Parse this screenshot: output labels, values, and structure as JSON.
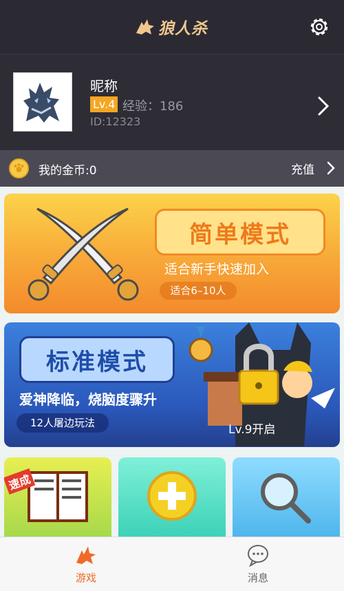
{
  "header": {
    "app_title": "狼人杀",
    "settings_icon": "gear-icon"
  },
  "profile": {
    "nickname": "昵称",
    "level": "Lv.4",
    "exp": "经验：186",
    "id": "ID:12323"
  },
  "coins": {
    "label": "我的金币:0",
    "recharge": "充值"
  },
  "modes": {
    "easy": {
      "title": "简单模式",
      "subtitle": "适合新手快速加入",
      "players": "适合6–10人"
    },
    "standard": {
      "title": "标准模式",
      "subtitle": "爱神降临，烧脑度骤升",
      "players": "12人屠边玩法",
      "lock": "Lv.9开启"
    }
  },
  "mini_cards": [
    {
      "icon": "rulebook-icon",
      "badge": "速成"
    },
    {
      "icon": "plus-icon"
    },
    {
      "icon": "search-icon"
    }
  ],
  "tabbar": {
    "game": "游戏",
    "messages": "消息"
  },
  "colors": {
    "accent": "#f06a2a",
    "header_bg": "#2b2a33",
    "level_badge": "#f6a623"
  }
}
